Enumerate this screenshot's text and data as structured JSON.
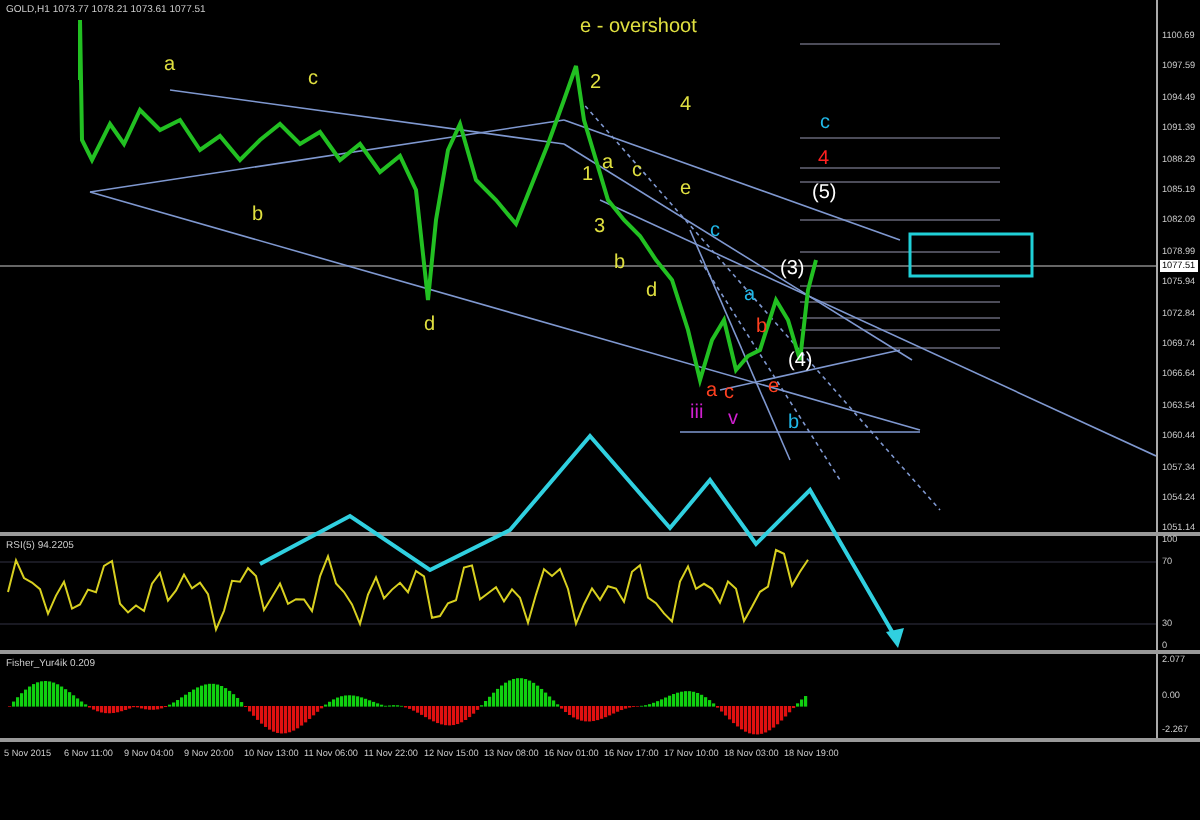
{
  "chart": {
    "symbol_info": "GOLD,H1 1073.77 1078.21 1073.61 1077.51",
    "wave_labels": [
      {
        "text": "e - overshoot",
        "color": "#e0e040"
      },
      {
        "text": "a",
        "color": "#e0e040"
      },
      {
        "text": "c",
        "color": "#e0e040"
      },
      {
        "text": "b",
        "color": "#e0e040"
      },
      {
        "text": "d",
        "color": "#e0e040"
      },
      {
        "text": "2",
        "color": "#e0e040"
      },
      {
        "text": "1",
        "color": "#e0e040"
      },
      {
        "text": "a",
        "color": "#e0e040"
      },
      {
        "text": "3",
        "color": "#e0e040"
      },
      {
        "text": "b",
        "color": "#e0e040"
      },
      {
        "text": "c",
        "color": "#e0e040"
      },
      {
        "text": "d",
        "color": "#e0e040"
      },
      {
        "text": "4",
        "color": "#e0e040"
      },
      {
        "text": "e",
        "color": "#e0e040"
      },
      {
        "text": "c",
        "color": "#20b8e8"
      },
      {
        "text": "4",
        "color": "#ff2020"
      },
      {
        "text": "(5)",
        "color": "#ffffff"
      },
      {
        "text": "(3)",
        "color": "#ffffff"
      },
      {
        "text": "(4)",
        "color": "#ffffff"
      },
      {
        "text": "a",
        "color": "#20b8e8"
      },
      {
        "text": "b",
        "color": "#ff4020"
      },
      {
        "text": "a",
        "color": "#ff4020"
      },
      {
        "text": "c",
        "color": "#ff4020"
      },
      {
        "text": "e",
        "color": "#ff4020"
      },
      {
        "text": "b",
        "color": "#20b8e8"
      },
      {
        "text": "iii",
        "color": "#d020d0"
      },
      {
        "text": "v",
        "color": "#d020d0"
      },
      {
        "text": "c",
        "color": "#20b8e8"
      }
    ],
    "price_axis": [
      "1100.69",
      "1097.59",
      "1094.49",
      "1091.39",
      "1088.29",
      "1085.19",
      "1082.09",
      "1078.99",
      "1075.94",
      "1072.84",
      "1069.74",
      "1066.64",
      "1063.54",
      "1060.44",
      "1057.34",
      "1054.24",
      "1051.14"
    ],
    "current_price": "1077.51"
  },
  "rsi": {
    "title": "RSI(5) 94.2205",
    "axis": [
      "100",
      "70",
      "30",
      "0"
    ]
  },
  "fisher": {
    "title": "Fisher_Yur4ik 0.209",
    "axis": [
      "2.077",
      "0.00",
      "-2.267"
    ]
  },
  "time_axis": [
    "5 Nov 2015",
    "6 Nov 11:00",
    "9 Nov 04:00",
    "9 Nov 20:00",
    "10 Nov 13:00",
    "11 Nov 06:00",
    "11 Nov 22:00",
    "12 Nov 15:00",
    "13 Nov 08:00",
    "16 Nov 01:00",
    "16 Nov 17:00",
    "17 Nov 10:00",
    "18 Nov 03:00",
    "18 Nov 19:00"
  ]
}
